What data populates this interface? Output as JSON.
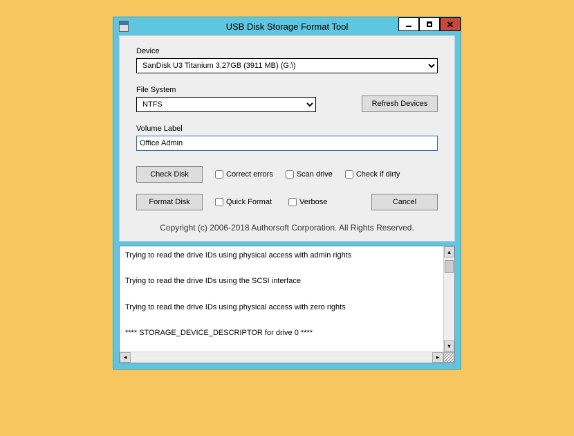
{
  "window": {
    "title": "USB Disk Storage Format Tool"
  },
  "form": {
    "device_label": "Device",
    "device_value": "SanDisk U3 Titanium 3.27GB (3911 MB)  (G:\\)",
    "filesystem_label": "File System",
    "filesystem_value": "NTFS",
    "refresh_button": "Refresh Devices",
    "volume_label": "Volume Label",
    "volume_value": "Office Admin",
    "check_disk_button": "Check Disk",
    "format_disk_button": "Format Disk",
    "cancel_button": "Cancel",
    "checkboxes": {
      "correct_errors": "Correct errors",
      "scan_drive": "Scan drive",
      "check_if_dirty": "Check if dirty",
      "quick_format": "Quick Format",
      "verbose": "Verbose"
    },
    "copyright": "Copyright (c) 2006-2018 Authorsoft Corporation. All Rights Reserved."
  },
  "log": {
    "lines": [
      "Trying to read the drive IDs using physical access with admin rights",
      "Trying to read the drive IDs using the SCSI interface",
      "Trying to read the drive IDs using physical access with zero rights",
      "**** STORAGE_DEVICE_DESCRIPTOR for drive 0 ****"
    ]
  }
}
